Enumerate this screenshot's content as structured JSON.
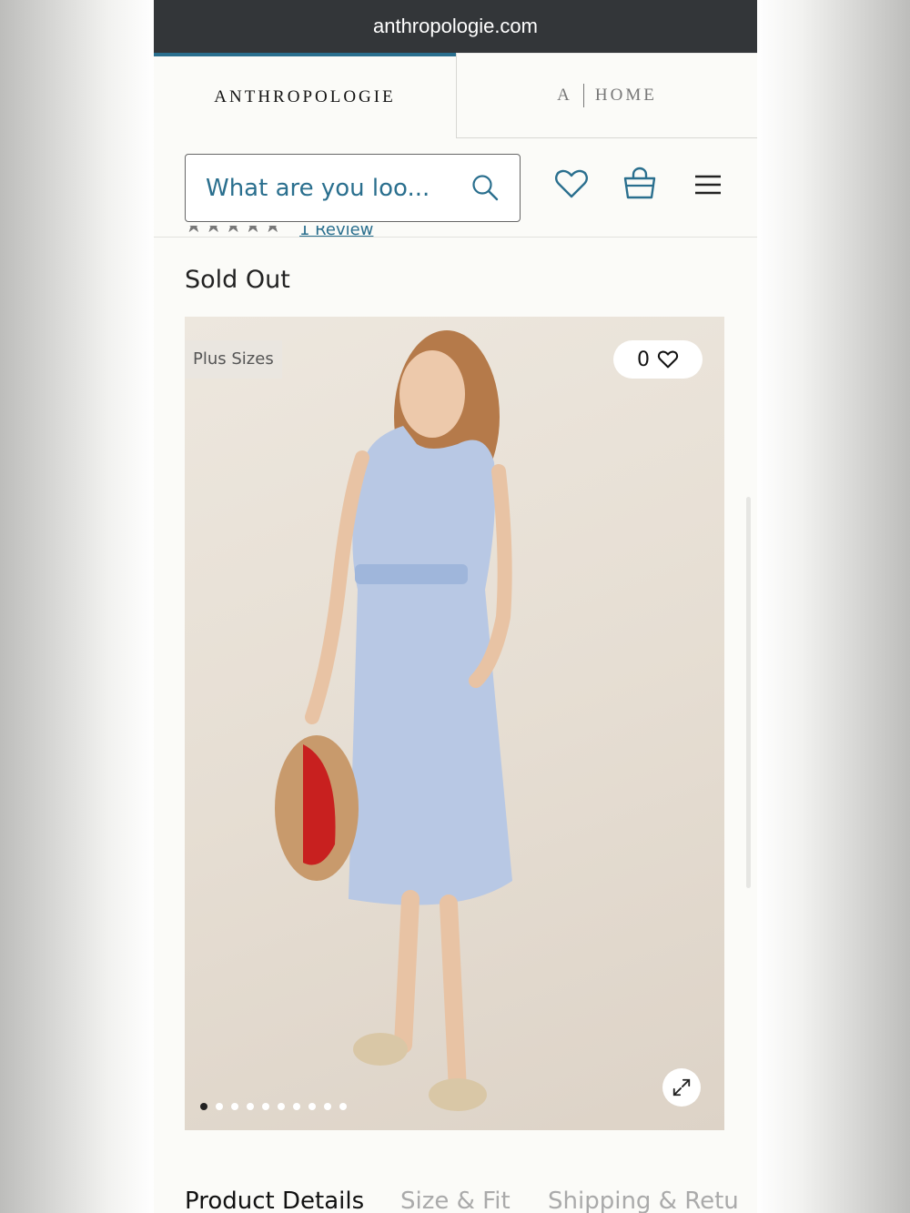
{
  "browser": {
    "url": "anthropologie.com"
  },
  "tabs": {
    "brand": "ANTHROPOLOGIE",
    "home_a": "A",
    "home": "HOME"
  },
  "header": {
    "search_placeholder": "What are you loo...",
    "icons": [
      "search-icon",
      "heart-icon",
      "shopping-bag-icon",
      "menu-icon"
    ]
  },
  "product": {
    "rating_stars": "★★★★★",
    "reviews_link": "1 Review",
    "status": "Sold Out",
    "badge": "Plus Sizes",
    "like_count": "0",
    "carousel": {
      "total": 10,
      "active_index": 0
    }
  },
  "detail_tabs": [
    "Product Details",
    "Size & Fit",
    "Shipping & Retu"
  ],
  "colors": {
    "accent": "#2a6f8e",
    "urlbar": "#333639",
    "background": "#fbfbf8"
  }
}
